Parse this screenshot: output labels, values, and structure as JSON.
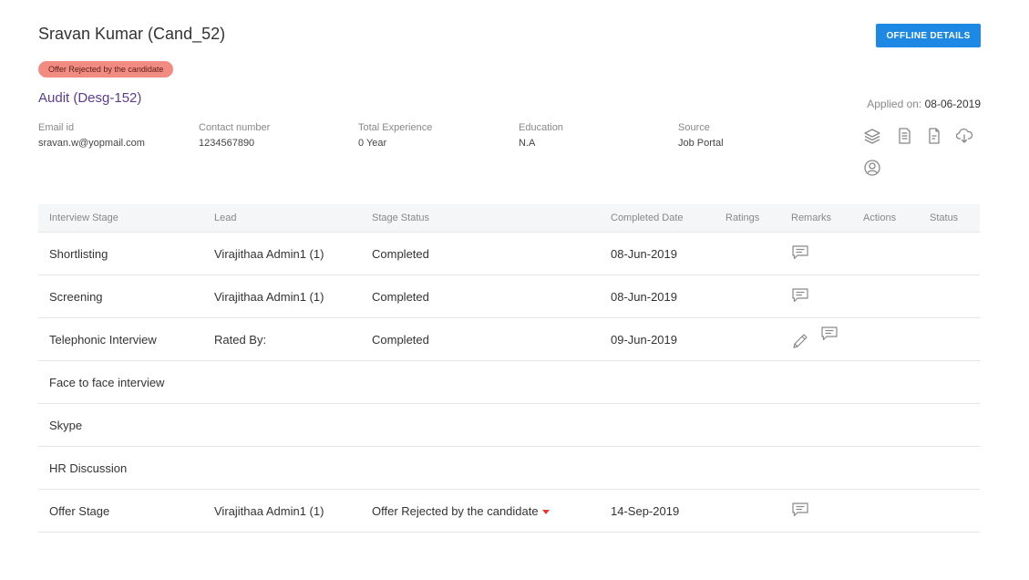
{
  "candidate": {
    "name": "Sravan Kumar (Cand_52)",
    "status_badge": "Offer Rejected by the candidate",
    "job_title": "Audit (Desg-152)",
    "applied_label": "Applied on:",
    "applied_date": "08-06-2019"
  },
  "header": {
    "offline_button": "OFFLINE DETAILS"
  },
  "info": [
    {
      "label": "Email id",
      "value": "sravan.w@yopmail.com"
    },
    {
      "label": "Contact number",
      "value": "1234567890"
    },
    {
      "label": "Total Experience",
      "value": "0 Year"
    },
    {
      "label": "Education",
      "value": "N.A"
    },
    {
      "label": "Source",
      "value": "Job Portal"
    }
  ],
  "action_icons": [
    "layers-icon",
    "document-icon",
    "resume-icon",
    "cloud-download-icon",
    "user-profile-icon"
  ],
  "table": {
    "headers": [
      "Interview Stage",
      "Lead",
      "Stage Status",
      "Completed Date",
      "Ratings",
      "Remarks",
      "Actions",
      "Status"
    ],
    "rows": [
      {
        "stage": "Shortlisting",
        "lead": "Virajithaa Admin1 (1)",
        "status": "Completed",
        "date": "08-Jun-2019"
      },
      {
        "stage": "Screening",
        "lead": "Virajithaa Admin1 (1)",
        "status": "Completed",
        "date": "08-Jun-2019"
      },
      {
        "stage": "Telephonic Interview",
        "lead": "Rated By:",
        "status": "Completed",
        "date": "09-Jun-2019"
      },
      {
        "stage": "Face to face interview",
        "lead": "",
        "status": "",
        "date": ""
      },
      {
        "stage": "Skype",
        "lead": "",
        "status": "",
        "date": ""
      },
      {
        "stage": "HR Discussion",
        "lead": "",
        "status": "",
        "date": ""
      },
      {
        "stage": "Offer Stage",
        "lead": "Virajithaa Admin1 (1)",
        "status": "Offer Rejected by the candidate",
        "date": "14-Sep-2019"
      }
    ]
  },
  "colors": {
    "primary_button": "#1e88e5",
    "badge_bg": "#f28b82",
    "job_title": "#5b3c91",
    "completed": "#43a047",
    "rejected": "#e53935"
  }
}
